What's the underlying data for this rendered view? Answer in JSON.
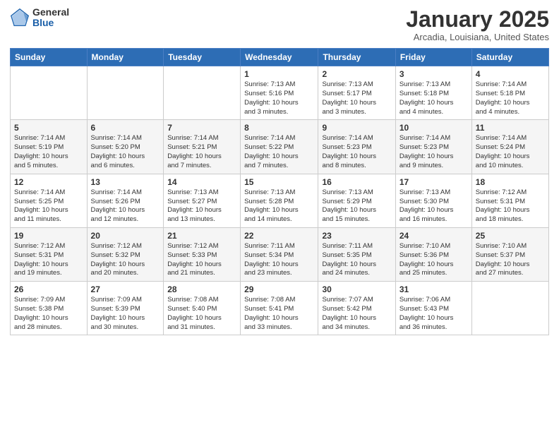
{
  "logo": {
    "general": "General",
    "blue": "Blue"
  },
  "header": {
    "month": "January 2025",
    "location": "Arcadia, Louisiana, United States"
  },
  "weekdays": [
    "Sunday",
    "Monday",
    "Tuesday",
    "Wednesday",
    "Thursday",
    "Friday",
    "Saturday"
  ],
  "weeks": [
    [
      {
        "day": "",
        "info": ""
      },
      {
        "day": "",
        "info": ""
      },
      {
        "day": "",
        "info": ""
      },
      {
        "day": "1",
        "info": "Sunrise: 7:13 AM\nSunset: 5:16 PM\nDaylight: 10 hours\nand 3 minutes."
      },
      {
        "day": "2",
        "info": "Sunrise: 7:13 AM\nSunset: 5:17 PM\nDaylight: 10 hours\nand 3 minutes."
      },
      {
        "day": "3",
        "info": "Sunrise: 7:13 AM\nSunset: 5:18 PM\nDaylight: 10 hours\nand 4 minutes."
      },
      {
        "day": "4",
        "info": "Sunrise: 7:14 AM\nSunset: 5:18 PM\nDaylight: 10 hours\nand 4 minutes."
      }
    ],
    [
      {
        "day": "5",
        "info": "Sunrise: 7:14 AM\nSunset: 5:19 PM\nDaylight: 10 hours\nand 5 minutes."
      },
      {
        "day": "6",
        "info": "Sunrise: 7:14 AM\nSunset: 5:20 PM\nDaylight: 10 hours\nand 6 minutes."
      },
      {
        "day": "7",
        "info": "Sunrise: 7:14 AM\nSunset: 5:21 PM\nDaylight: 10 hours\nand 7 minutes."
      },
      {
        "day": "8",
        "info": "Sunrise: 7:14 AM\nSunset: 5:22 PM\nDaylight: 10 hours\nand 7 minutes."
      },
      {
        "day": "9",
        "info": "Sunrise: 7:14 AM\nSunset: 5:23 PM\nDaylight: 10 hours\nand 8 minutes."
      },
      {
        "day": "10",
        "info": "Sunrise: 7:14 AM\nSunset: 5:23 PM\nDaylight: 10 hours\nand 9 minutes."
      },
      {
        "day": "11",
        "info": "Sunrise: 7:14 AM\nSunset: 5:24 PM\nDaylight: 10 hours\nand 10 minutes."
      }
    ],
    [
      {
        "day": "12",
        "info": "Sunrise: 7:14 AM\nSunset: 5:25 PM\nDaylight: 10 hours\nand 11 minutes."
      },
      {
        "day": "13",
        "info": "Sunrise: 7:14 AM\nSunset: 5:26 PM\nDaylight: 10 hours\nand 12 minutes."
      },
      {
        "day": "14",
        "info": "Sunrise: 7:13 AM\nSunset: 5:27 PM\nDaylight: 10 hours\nand 13 minutes."
      },
      {
        "day": "15",
        "info": "Sunrise: 7:13 AM\nSunset: 5:28 PM\nDaylight: 10 hours\nand 14 minutes."
      },
      {
        "day": "16",
        "info": "Sunrise: 7:13 AM\nSunset: 5:29 PM\nDaylight: 10 hours\nand 15 minutes."
      },
      {
        "day": "17",
        "info": "Sunrise: 7:13 AM\nSunset: 5:30 PM\nDaylight: 10 hours\nand 16 minutes."
      },
      {
        "day": "18",
        "info": "Sunrise: 7:12 AM\nSunset: 5:31 PM\nDaylight: 10 hours\nand 18 minutes."
      }
    ],
    [
      {
        "day": "19",
        "info": "Sunrise: 7:12 AM\nSunset: 5:31 PM\nDaylight: 10 hours\nand 19 minutes."
      },
      {
        "day": "20",
        "info": "Sunrise: 7:12 AM\nSunset: 5:32 PM\nDaylight: 10 hours\nand 20 minutes."
      },
      {
        "day": "21",
        "info": "Sunrise: 7:12 AM\nSunset: 5:33 PM\nDaylight: 10 hours\nand 21 minutes."
      },
      {
        "day": "22",
        "info": "Sunrise: 7:11 AM\nSunset: 5:34 PM\nDaylight: 10 hours\nand 23 minutes."
      },
      {
        "day": "23",
        "info": "Sunrise: 7:11 AM\nSunset: 5:35 PM\nDaylight: 10 hours\nand 24 minutes."
      },
      {
        "day": "24",
        "info": "Sunrise: 7:10 AM\nSunset: 5:36 PM\nDaylight: 10 hours\nand 25 minutes."
      },
      {
        "day": "25",
        "info": "Sunrise: 7:10 AM\nSunset: 5:37 PM\nDaylight: 10 hours\nand 27 minutes."
      }
    ],
    [
      {
        "day": "26",
        "info": "Sunrise: 7:09 AM\nSunset: 5:38 PM\nDaylight: 10 hours\nand 28 minutes."
      },
      {
        "day": "27",
        "info": "Sunrise: 7:09 AM\nSunset: 5:39 PM\nDaylight: 10 hours\nand 30 minutes."
      },
      {
        "day": "28",
        "info": "Sunrise: 7:08 AM\nSunset: 5:40 PM\nDaylight: 10 hours\nand 31 minutes."
      },
      {
        "day": "29",
        "info": "Sunrise: 7:08 AM\nSunset: 5:41 PM\nDaylight: 10 hours\nand 33 minutes."
      },
      {
        "day": "30",
        "info": "Sunrise: 7:07 AM\nSunset: 5:42 PM\nDaylight: 10 hours\nand 34 minutes."
      },
      {
        "day": "31",
        "info": "Sunrise: 7:06 AM\nSunset: 5:43 PM\nDaylight: 10 hours\nand 36 minutes."
      },
      {
        "day": "",
        "info": ""
      }
    ]
  ]
}
